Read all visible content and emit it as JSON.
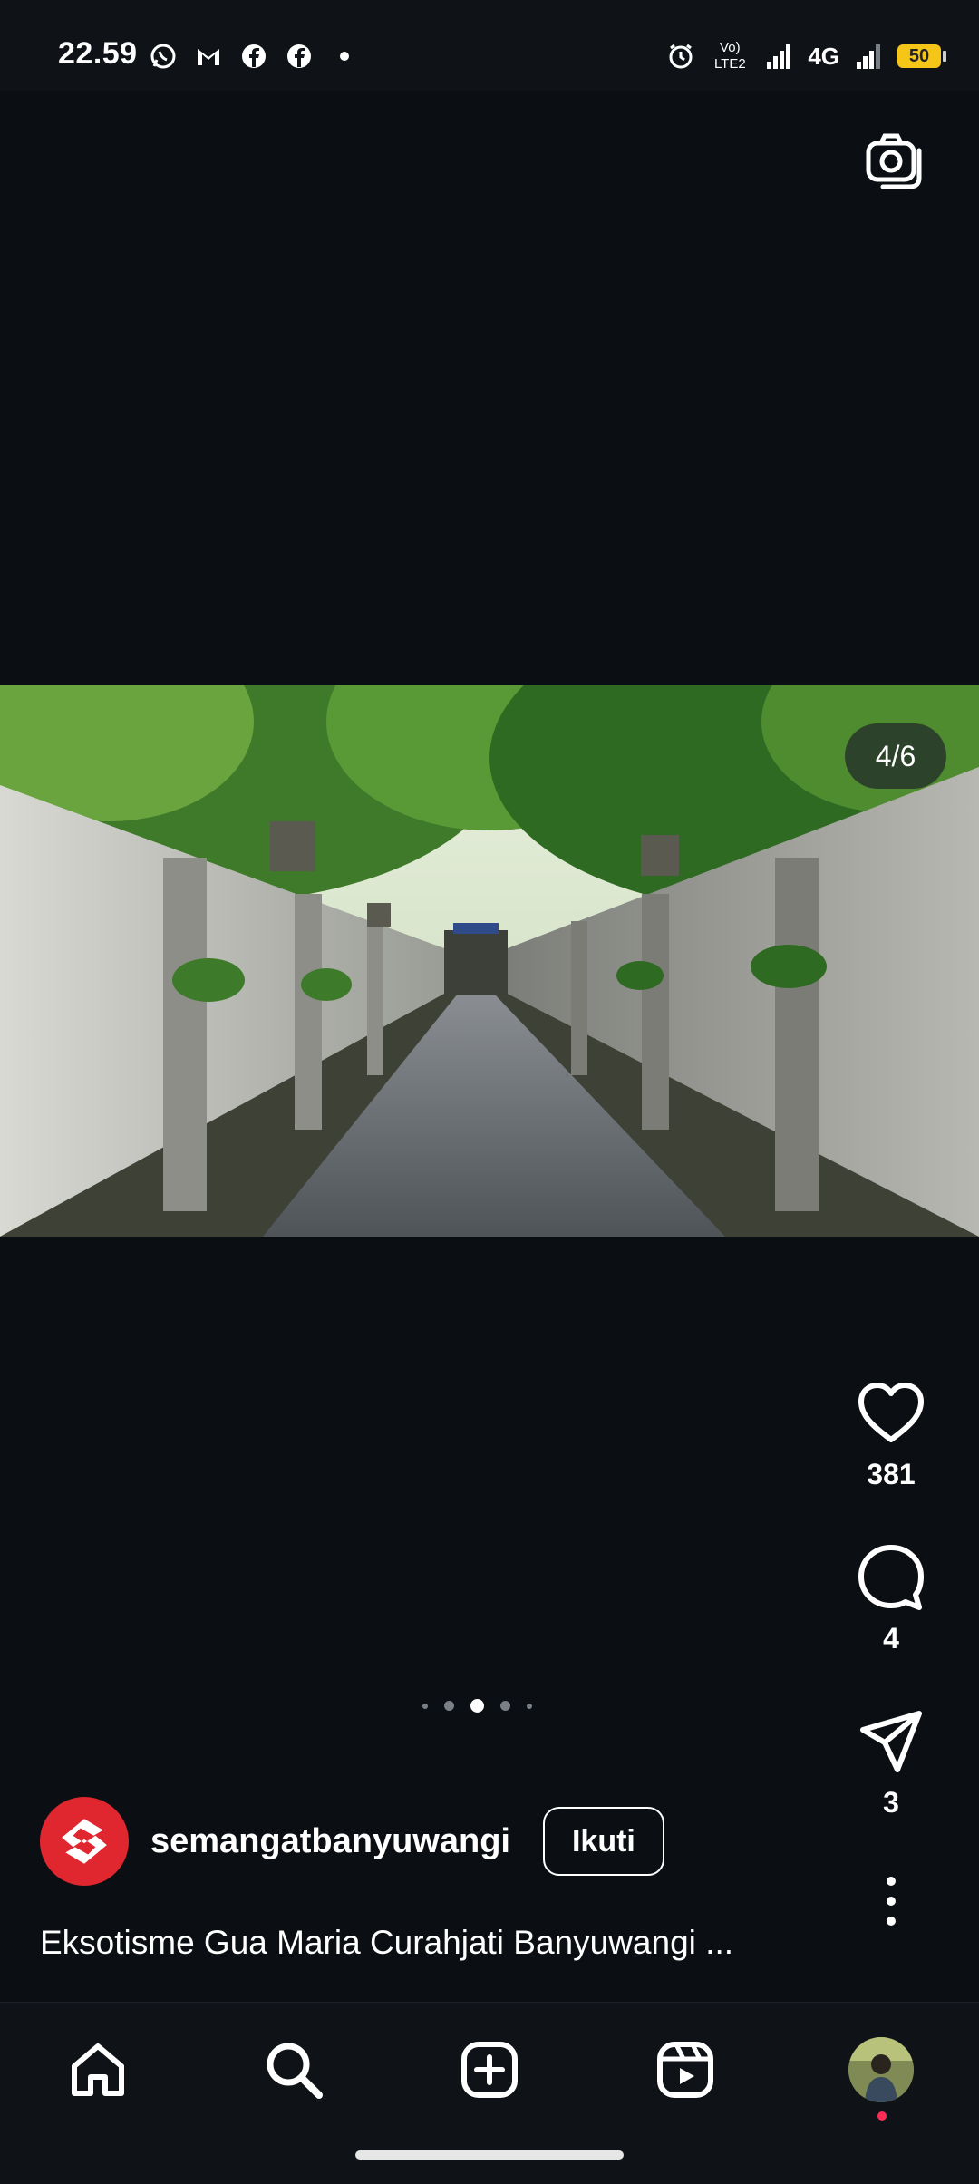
{
  "status_bar": {
    "time": "22.59",
    "network_label": "4G",
    "volte_label": "LTE2",
    "battery_level": "50",
    "icons": [
      "whatsapp-icon",
      "gmail-icon",
      "facebook-icon",
      "facebook-icon",
      "dot-icon",
      "alarm-icon",
      "volte-icon",
      "signal-icon",
      "signal-icon",
      "battery-icon"
    ]
  },
  "post": {
    "image_counter": "4/6",
    "likes": "381",
    "comments": "4",
    "shares": "3",
    "username": "semangatbanyuwangi",
    "follow_label": "Ikuti",
    "caption": "Eksotisme Gua Maria Curahjati Banyuwangi ...",
    "carousel": {
      "total_dots": 5,
      "active_index": 2
    }
  },
  "bottom_nav": {
    "items": [
      "home-icon",
      "search-icon",
      "create-icon",
      "reels-icon",
      "profile-avatar"
    ]
  },
  "colors": {
    "background": "#0b0f14",
    "avatar_brand": "#e0262e",
    "battery": "#f5c518",
    "notification_dot": "#ff2d55"
  }
}
